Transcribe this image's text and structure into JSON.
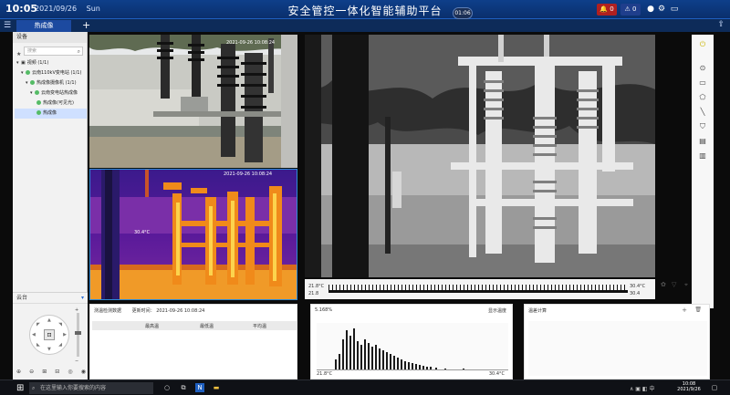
{
  "topbar": {
    "time": "10:05",
    "date": "2021/09/26",
    "weekday": "Sun",
    "title": "安全管控一体化智能辅助平台",
    "clock_badge": "01:06",
    "alarm_count": "0",
    "notice_count": "0"
  },
  "tabs": {
    "active_label": "热成像",
    "add_label": "+"
  },
  "left_panel": {
    "header": "设备",
    "search_placeholder": "搜索",
    "tree": [
      {
        "label": "视频 (1/1)"
      },
      {
        "label": "云南110kV变电站 (1/1)"
      },
      {
        "label": "热成像摄像机 (1/1)"
      },
      {
        "label": "云南变电站热成像"
      },
      {
        "label": "热成像(可见光)"
      },
      {
        "label": "热成像"
      }
    ]
  },
  "ptz": {
    "header": "云台"
  },
  "main_view": {
    "min_temp": "21.8°C",
    "max_temp": "30.4°C",
    "min_small": "21.8",
    "max_small": "30.4"
  },
  "thermal_cell": {
    "timestamp": "2021-09-26 10:08:24",
    "spot": "30.4°C"
  },
  "visible_cell": {
    "timestamp": "2021-09-26 10:08:24"
  },
  "panel_detect": {
    "title": "测温检测数据",
    "update_label": "更新时间：",
    "update_time": "2021-09-26 10:08:24",
    "columns": [
      "",
      "最高温",
      "最低温",
      "平均温"
    ]
  },
  "panel_hist": {
    "left_value": "5.168%",
    "right_value": "显示温度",
    "axis_min": "21.8°C",
    "axis_max": "30.4°C"
  },
  "panel_calc": {
    "title": "温差计算"
  },
  "taskbar": {
    "search_placeholder": "在这里输入你要搜索的内容",
    "time": "10:08",
    "date": "2021/9/26"
  }
}
